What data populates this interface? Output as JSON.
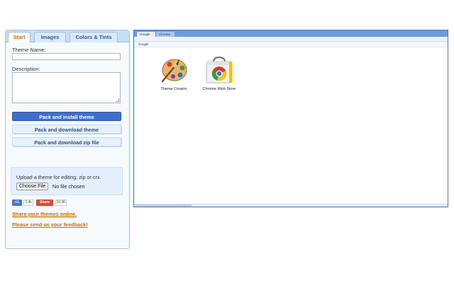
{
  "tabs": [
    "Start",
    "Images",
    "Colors & Tints"
  ],
  "form": {
    "theme_name_label": "Theme Name:",
    "theme_name_value": "",
    "description_label": "Description:",
    "description_value": ""
  },
  "buttons": {
    "pack_install": "Pack and install theme",
    "pack_download": "Pack and download theme",
    "pack_download_zip": "Pack and download zip file"
  },
  "upload": {
    "text": "Upload a theme for editing, zip or crx.",
    "choose_file": "Choose File",
    "status": "No file chosen"
  },
  "social": {
    "gplus_label": "+1",
    "gplus_count": "2.4k",
    "share_label": "Share",
    "share_count": "10.3K"
  },
  "links": {
    "share_themes": "Share your themes online.",
    "feedback": "Please send us your feedback!"
  },
  "preview": {
    "tabs": [
      "Google",
      "Chrome"
    ],
    "bookmark": "Google",
    "apps": [
      {
        "name": "Theme Creator",
        "icon": "paint-palette-icon"
      },
      {
        "name": "Chrome Web Store",
        "icon": "chrome-web-store-icon"
      }
    ]
  },
  "colors": {
    "accent": "#e06a00",
    "primary_button": "#3d6fd0",
    "frame": "#6c9be0"
  }
}
